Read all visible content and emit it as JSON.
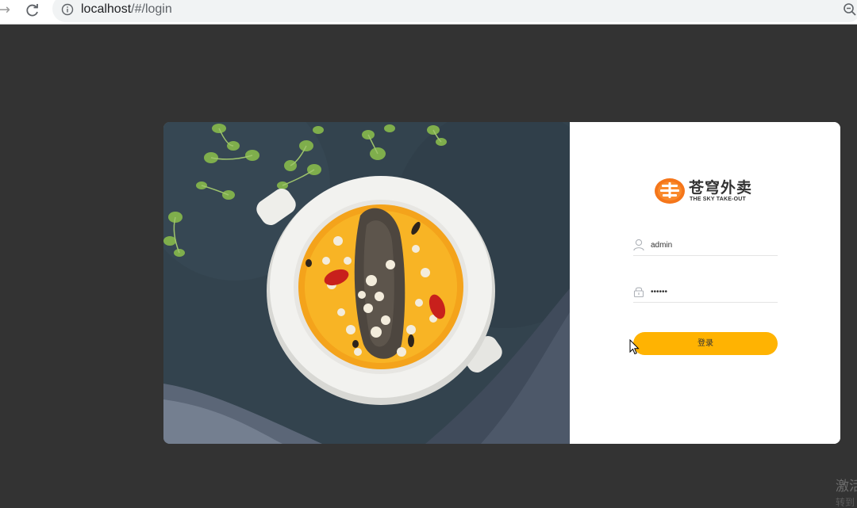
{
  "browser": {
    "url_host": "localhost",
    "url_path": "/#/login",
    "back_icon": "arrow-right-icon",
    "reload_icon": "reload-icon",
    "info_icon": "info-icon",
    "zoom_icon": "zoom-out-icon"
  },
  "login": {
    "logo": {
      "title": "苍穹外卖",
      "subtitle": "THE SKY TAKE-OUT",
      "badge_color": "#f5761a"
    },
    "username": {
      "value": "admin",
      "icon": "user-icon"
    },
    "password": {
      "value": "123456",
      "icon": "lock-icon"
    },
    "submit_label": "登录",
    "accent_color": "#ffb302"
  },
  "watermark": {
    "line1": "激活",
    "line2": "转到"
  }
}
